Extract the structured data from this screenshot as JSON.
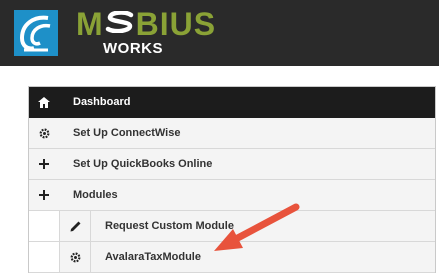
{
  "brand": {
    "name_left": "M",
    "name_right": "BIUS",
    "subtitle": "WORKS"
  },
  "menu": {
    "items": [
      {
        "label": "Dashboard",
        "icon": "home-icon",
        "active": true
      },
      {
        "label": "Set Up ConnectWise",
        "icon": "gear-icon"
      },
      {
        "label": "Set Up QuickBooks Online",
        "icon": "plus-icon"
      },
      {
        "label": "Modules",
        "icon": "plus-icon"
      }
    ],
    "subitems": [
      {
        "label": "Request Custom Module",
        "icon": "pencil-icon"
      },
      {
        "label": "AvalaraTaxModule",
        "icon": "gear-icon"
      }
    ]
  },
  "annotation": {
    "arrow_color": "#e8533c"
  },
  "colors": {
    "header_bg": "#2a2a2a",
    "logo_blue": "#1e90c8",
    "brand_green": "#8aa236",
    "active_bg": "#1c1c1c"
  }
}
